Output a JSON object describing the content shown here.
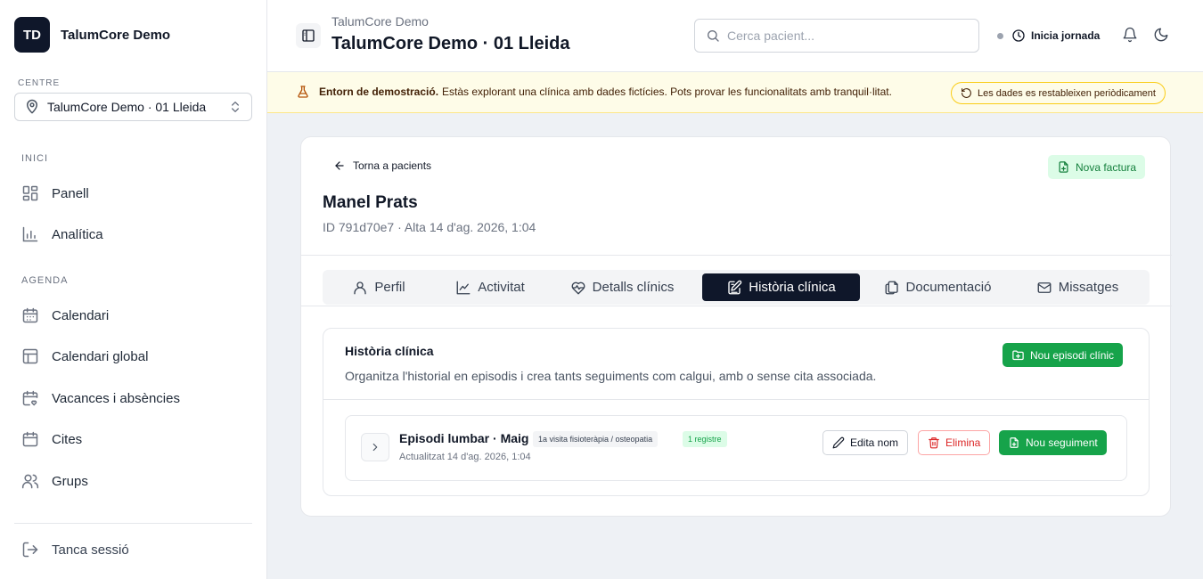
{
  "sidebar": {
    "avatar_initials": "TD",
    "brand_name": "TalumCore Demo",
    "centre_label": "CENTRE",
    "centre_value": "TalumCore Demo · 01 Lleida",
    "sections": [
      {
        "label": "INICI",
        "items": [
          {
            "label": "Panell",
            "icon": "grid-icon"
          },
          {
            "label": "Analítica",
            "icon": "chart-icon"
          }
        ]
      },
      {
        "label": "AGENDA",
        "items": [
          {
            "label": "Calendari",
            "icon": "calendar-icon"
          },
          {
            "label": "Calendari global",
            "icon": "layout-icon"
          },
          {
            "label": "Vacances i absències",
            "icon": "calendar-heart-icon"
          },
          {
            "label": "Cites",
            "icon": "calendar-icon"
          },
          {
            "label": "Grups",
            "icon": "users-icon"
          }
        ]
      }
    ],
    "logout_label": "Tanca sessió"
  },
  "header": {
    "subtitle": "TalumCore Demo",
    "title": "TalumCore Demo · 01 Lleida",
    "search_placeholder": "Cerca pacient...",
    "jornada_label": "Inicia jornada"
  },
  "banner": {
    "bold": "Entorn de demostració.",
    "text": "Estàs explorant una clínica amb dades fictícies. Pots provar les funcionalitats amb tranquil·litat.",
    "pill": "Les dades es restableixen periòdicament"
  },
  "patient": {
    "back_label": "Torna a pacients",
    "invoice_label": "Nova factura",
    "name": "Manel Prats",
    "meta": "ID 791d70e7 · Alta 14 d'ag. 2026, 1:04"
  },
  "tabs": [
    {
      "label": "Perfil",
      "icon": "user-icon",
      "active": false
    },
    {
      "label": "Activitat",
      "icon": "activity-icon",
      "active": false
    },
    {
      "label": "Detalls clínics",
      "icon": "heart-pulse-icon",
      "active": false
    },
    {
      "label": "Història clínica",
      "icon": "edit-note-icon",
      "active": true
    },
    {
      "label": "Documentació",
      "icon": "documents-icon",
      "active": false
    },
    {
      "label": "Missatges",
      "icon": "mail-icon",
      "active": false
    }
  ],
  "history": {
    "title": "Història clínica",
    "description": "Organitza l'historial en episodis i crea tants seguiments com calgui, amb o sense cita associada.",
    "new_episode_label": "Nou episodi clínic",
    "episodes": [
      {
        "title": "Episodi lumbar · Maig",
        "type_badge": "1a visita fisioteràpia / osteopatia",
        "count_badge": "1 registre",
        "updated": "Actualitzat 14 d'ag. 2026, 1:04",
        "edit_label": "Edita nom",
        "delete_label": "Elimina",
        "followup_label": "Nou seguiment"
      }
    ]
  },
  "colors": {
    "accent": "#16a34a",
    "dark": "#0f172a",
    "danger": "#dc2626",
    "banner_bg": "#fefce8"
  }
}
